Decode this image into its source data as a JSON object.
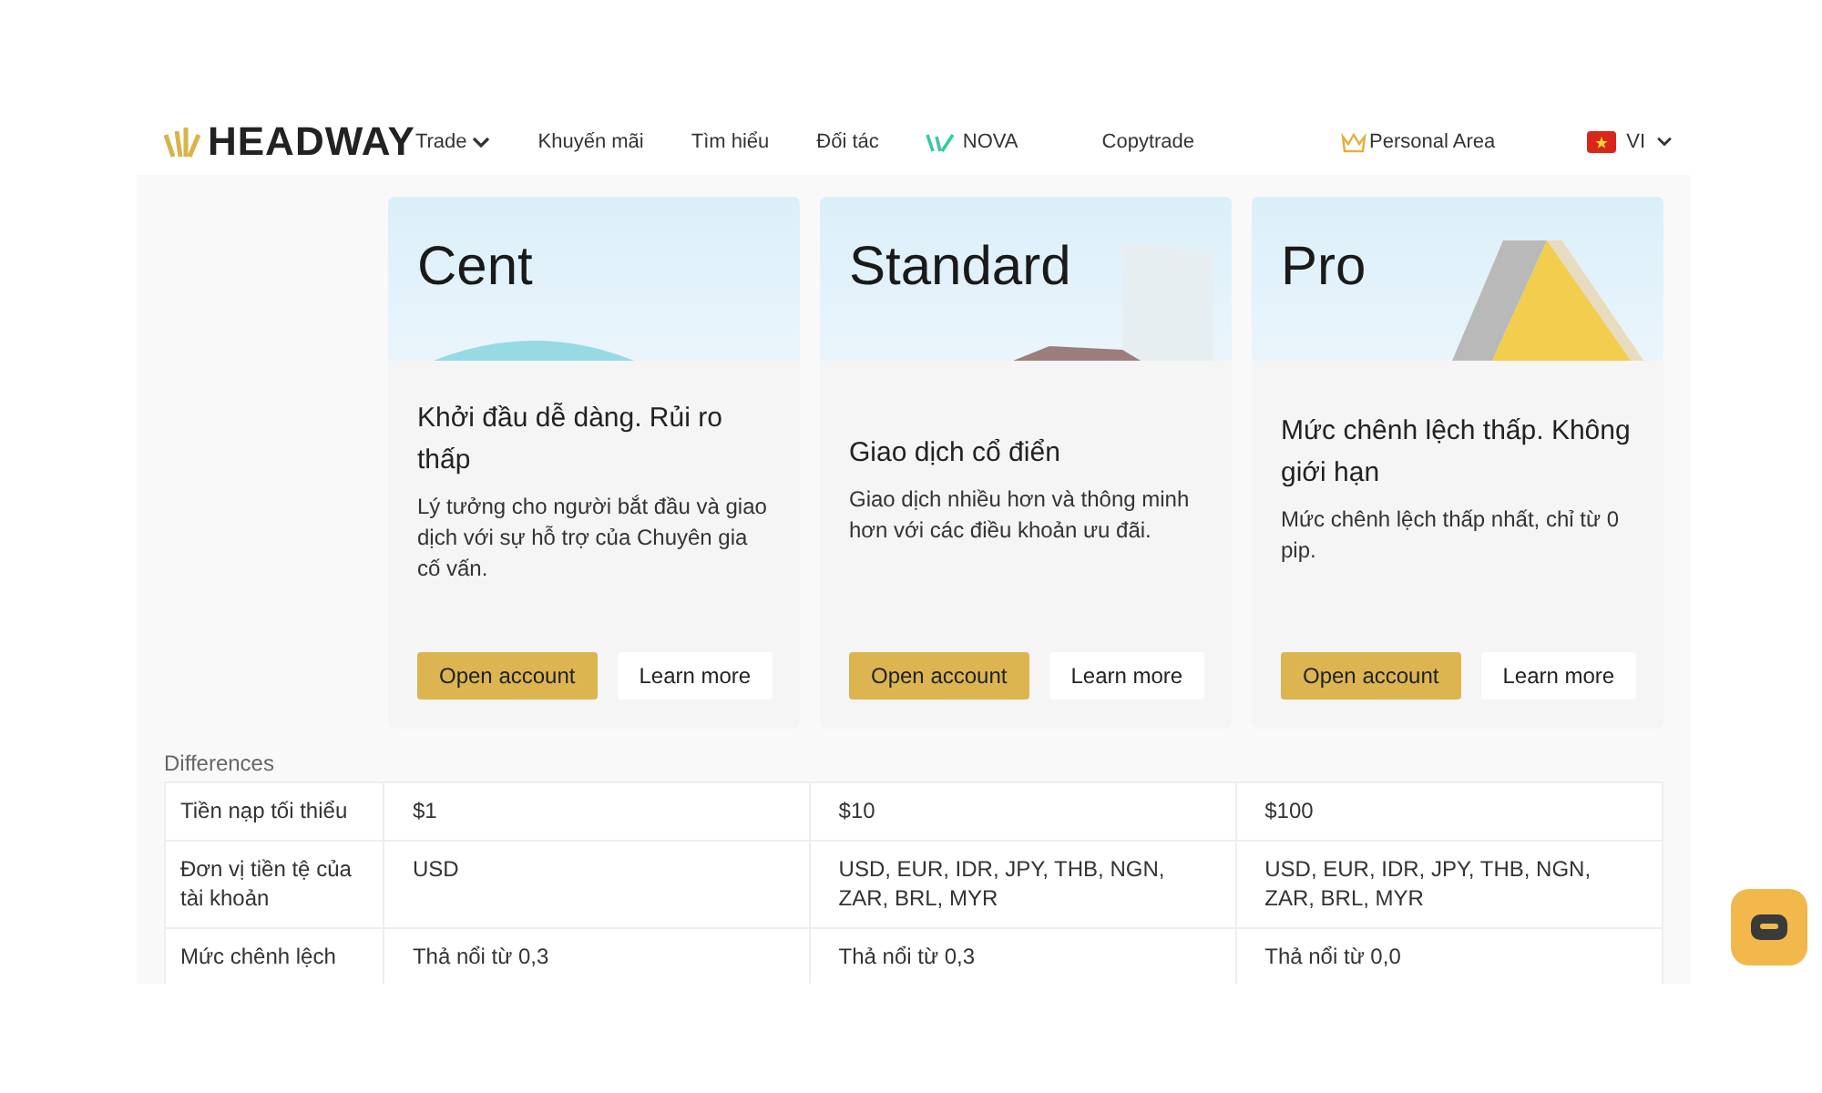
{
  "header": {
    "logo": "HEADWAY",
    "nav": [
      {
        "label": "Trade",
        "kind": "dropdown"
      },
      {
        "label": "Khuyến mãi",
        "kind": "plain"
      },
      {
        "label": "Tìm hiểu",
        "kind": "plain"
      },
      {
        "label": "Đối tác",
        "kind": "plain"
      },
      {
        "label": "NOVA",
        "kind": "nova"
      },
      {
        "label": "Copytrade",
        "kind": "plain"
      }
    ],
    "personal_area": "Personal Area",
    "language": "VI"
  },
  "cards": [
    {
      "title": "Cent",
      "kind": "cent",
      "tagline": "Khởi đầu dễ dàng. Rủi ro thấp",
      "description": "Lý tưởng cho người bắt đầu và giao dịch với sự hỗ trợ của Chuyên gia cố vấn.",
      "primary": "Open account",
      "secondary": "Learn more"
    },
    {
      "title": "Standard",
      "kind": "standard",
      "tagline": "Giao dịch cổ điển",
      "description": "Giao dịch nhiều hơn và thông minh hơn với các điều khoản ưu đãi.",
      "primary": "Open account",
      "secondary": "Learn more"
    },
    {
      "title": "Pro",
      "kind": "pro",
      "tagline": "Mức chênh lệch thấp. Không giới hạn",
      "description": "Mức chênh lệch thấp nhất, chỉ từ 0 pip.",
      "primary": "Open account",
      "secondary": "Learn more"
    }
  ],
  "differences": {
    "title": "Differences",
    "rows": [
      {
        "label": "Tiền nạp tối thiểu",
        "values": [
          "$1",
          "$10",
          "$100"
        ]
      },
      {
        "label": "Đơn vị tiền tệ của tài khoản",
        "values": [
          "USD",
          "USD, EUR, IDR, JPY, THB, NGN, ZAR, BRL, MYR",
          "USD, EUR, IDR, JPY, THB, NGN, ZAR, BRL, MYR"
        ]
      },
      {
        "label": "Mức chênh lệch",
        "values": [
          "Thả nổi từ 0,3",
          "Thả nổi từ 0,3",
          "Thả nổi từ 0,0"
        ]
      }
    ]
  }
}
